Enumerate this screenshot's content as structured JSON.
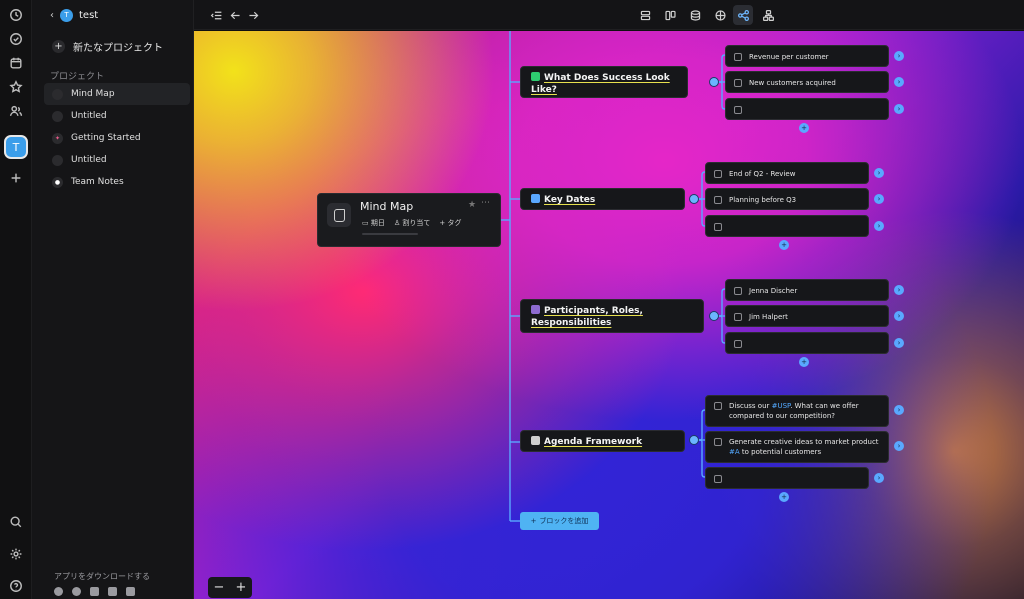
{
  "workspace": {
    "name": "test",
    "avatar_letter": "T",
    "rail_avatar": "T"
  },
  "sidebar": {
    "new_project_label": "新たなプロジェクト",
    "section_label": "プロジェクト",
    "projects": [
      {
        "label": "Mind Map",
        "icon": "mindmap-doc-icon",
        "active": true
      },
      {
        "label": "Untitled",
        "icon": "doc-icon",
        "active": false
      },
      {
        "label": "Getting Started",
        "icon": "rocket-icon",
        "active": false
      },
      {
        "label": "Untitled",
        "icon": "doc-icon",
        "active": false
      },
      {
        "label": "Team Notes",
        "icon": "chat-icon",
        "active": false
      }
    ],
    "download_label": "アプリをダウンロードする"
  },
  "root": {
    "title": "Mind Map",
    "props": [
      "期日",
      "割り当て",
      "+ タグ"
    ]
  },
  "branches": [
    {
      "label": "What Does Success Look Like?",
      "emoji_color": "#2ecc71",
      "children": [
        "Revenue per customer",
        "New customers acquired",
        ""
      ]
    },
    {
      "label": "Key Dates",
      "emoji_color": "#5aa8ff",
      "children": [
        "End of Q2 - Review",
        "Planning before Q3",
        ""
      ]
    },
    {
      "label": "Participants, Roles, Responsibilities",
      "emoji_color": "#8e6bd1",
      "children": [
        "Jenna Discher",
        "Jim Halpert",
        ""
      ]
    },
    {
      "label": "Agenda Framework",
      "emoji_color": "#cfcfcf",
      "children": [
        {
          "pre": "Discuss our ",
          "tag": "#USP",
          "post": ". What can we offer compared to our competition?"
        },
        {
          "pre": "Generate creative ideas to market product ",
          "tag": "#A",
          "post": " to potential customers"
        },
        ""
      ]
    }
  ],
  "add_block_label": "ブロックを追加",
  "zoom": {
    "minus": "−",
    "plus": "+"
  },
  "colors": {
    "accent": "#5aa8ff",
    "add_block_bg": "#4fb3f3"
  }
}
